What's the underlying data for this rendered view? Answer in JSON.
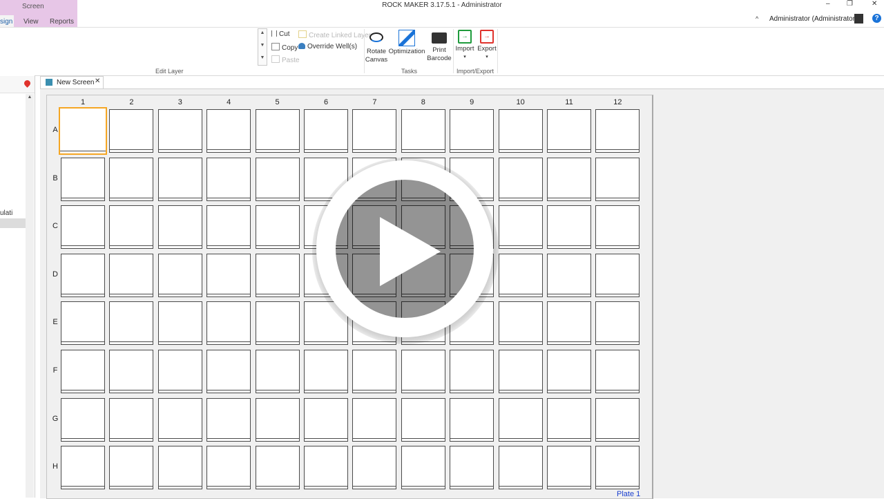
{
  "window": {
    "title": "ROCK MAKER 3.17.5.1 - Administrator",
    "context_group": "Screen",
    "minimize_glyph": "–",
    "restore_glyph": "❐",
    "close_glyph": "✕"
  },
  "ribbon_tabs": [
    {
      "label": "sign"
    },
    {
      "label": "View"
    },
    {
      "label": "Reports"
    }
  ],
  "user": {
    "label": "Administrator (Administrators)",
    "chevron": "^",
    "help_glyph": "?"
  },
  "ribbon": {
    "edit_layer": {
      "label": "Edit Layer",
      "cut": "Cut",
      "copy": "Copy",
      "paste": "Paste",
      "create_linked_layer": "Create Linked Layer",
      "override_wells": "Override Well(s)"
    },
    "tasks": {
      "label": "Tasks",
      "rotate_line1": "Rotate",
      "rotate_line2": "Canvas",
      "optimization": "Optimization",
      "print_line1": "Print",
      "print_line2": "Barcode"
    },
    "import_export": {
      "label": "Import/Export",
      "import": "Import",
      "export": "Export",
      "dropdown_glyph": "▾"
    }
  },
  "left_pane": {
    "partial_item": "ulati"
  },
  "document_tab": {
    "label": "New Screen",
    "close_glyph": "✕"
  },
  "plate": {
    "columns": [
      "1",
      "2",
      "3",
      "4",
      "5",
      "6",
      "7",
      "8",
      "9",
      "10",
      "11",
      "12"
    ],
    "rows": [
      "A",
      "B",
      "C",
      "D",
      "E",
      "F",
      "G",
      "H"
    ],
    "selected_well": "A1",
    "footer_label": "Plate 1"
  },
  "overlay": {
    "icon": "play-icon"
  },
  "colors": {
    "context_group": "#e7c6e7",
    "selected_well": "#f5a623",
    "plate_label": "#1a3fcf",
    "help": "#1a73d8"
  }
}
